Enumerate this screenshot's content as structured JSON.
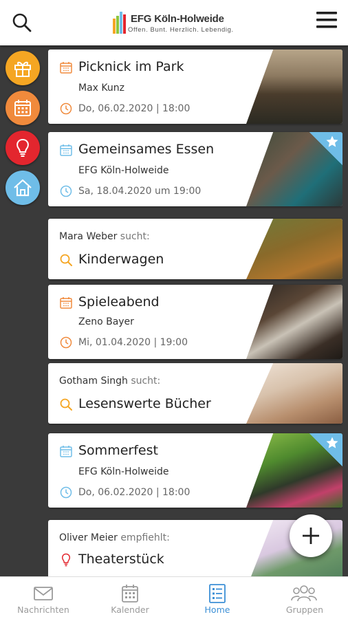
{
  "header": {
    "logo_name": "EFG Köln-Holweide",
    "logo_tagline": "Offen. Bunt. Herzlich. Lebendig.",
    "search_icon": "search-icon",
    "menu_icon": "hamburger-menu-icon"
  },
  "rail": {
    "items": [
      {
        "icon": "gift-icon",
        "color": "#f5a623"
      },
      {
        "icon": "calendar-icon",
        "color": "#f08a3c"
      },
      {
        "icon": "lightbulb-icon",
        "color": "#e3262e"
      },
      {
        "icon": "home-icon",
        "color": "#6fbde8"
      }
    ]
  },
  "feed": {
    "cards": [
      {
        "kind": "event",
        "title": "Picknick im Park",
        "subtitle": "Max Kunz",
        "date": "Do, 06.02.2020 | 18:00",
        "accent": "#f08a3c",
        "starred": false
      },
      {
        "kind": "event",
        "title": "Gemeinsames Essen",
        "subtitle": "EFG Köln-Holweide",
        "date": "Sa, 18.04.2020 um 19:00",
        "accent": "#6fbde8",
        "starred": true
      },
      {
        "kind": "search",
        "person": "Mara Weber",
        "verb": "sucht:",
        "title": "Kinderwagen"
      },
      {
        "kind": "event",
        "title": "Spieleabend",
        "subtitle": "Zeno Bayer",
        "date": "Mi, 01.04.2020 | 19:00",
        "accent": "#f08a3c",
        "starred": false
      },
      {
        "kind": "search",
        "person": "Gotham Singh",
        "verb": "sucht:",
        "title": "Lesenswerte Bücher"
      },
      {
        "kind": "event",
        "title": "Sommerfest",
        "subtitle": "EFG Köln-Holweide",
        "date": "Do, 06.02.2020 | 18:00",
        "accent": "#6fbde8",
        "starred": true
      },
      {
        "kind": "recommend",
        "person": "Oliver Meier",
        "verb": "empfiehlt:",
        "title": "Theaterstück"
      }
    ]
  },
  "fab": {
    "icon": "plus-icon"
  },
  "bottom_nav": {
    "items": [
      {
        "label": "Nachrichten",
        "icon": "envelope-icon",
        "active": false
      },
      {
        "label": "Kalender",
        "icon": "calendar-icon",
        "active": false
      },
      {
        "label": "Home",
        "icon": "feed-list-icon",
        "active": true
      },
      {
        "label": "Gruppen",
        "icon": "group-icon",
        "active": false
      }
    ]
  },
  "colors": {
    "accent_blue": "#3b8fd6",
    "badge_blue": "#6fbde8",
    "orange": "#f08a3c",
    "search_yellow": "#f5a623",
    "bulb_red": "#e3262e",
    "background": "#3a3a3a"
  }
}
